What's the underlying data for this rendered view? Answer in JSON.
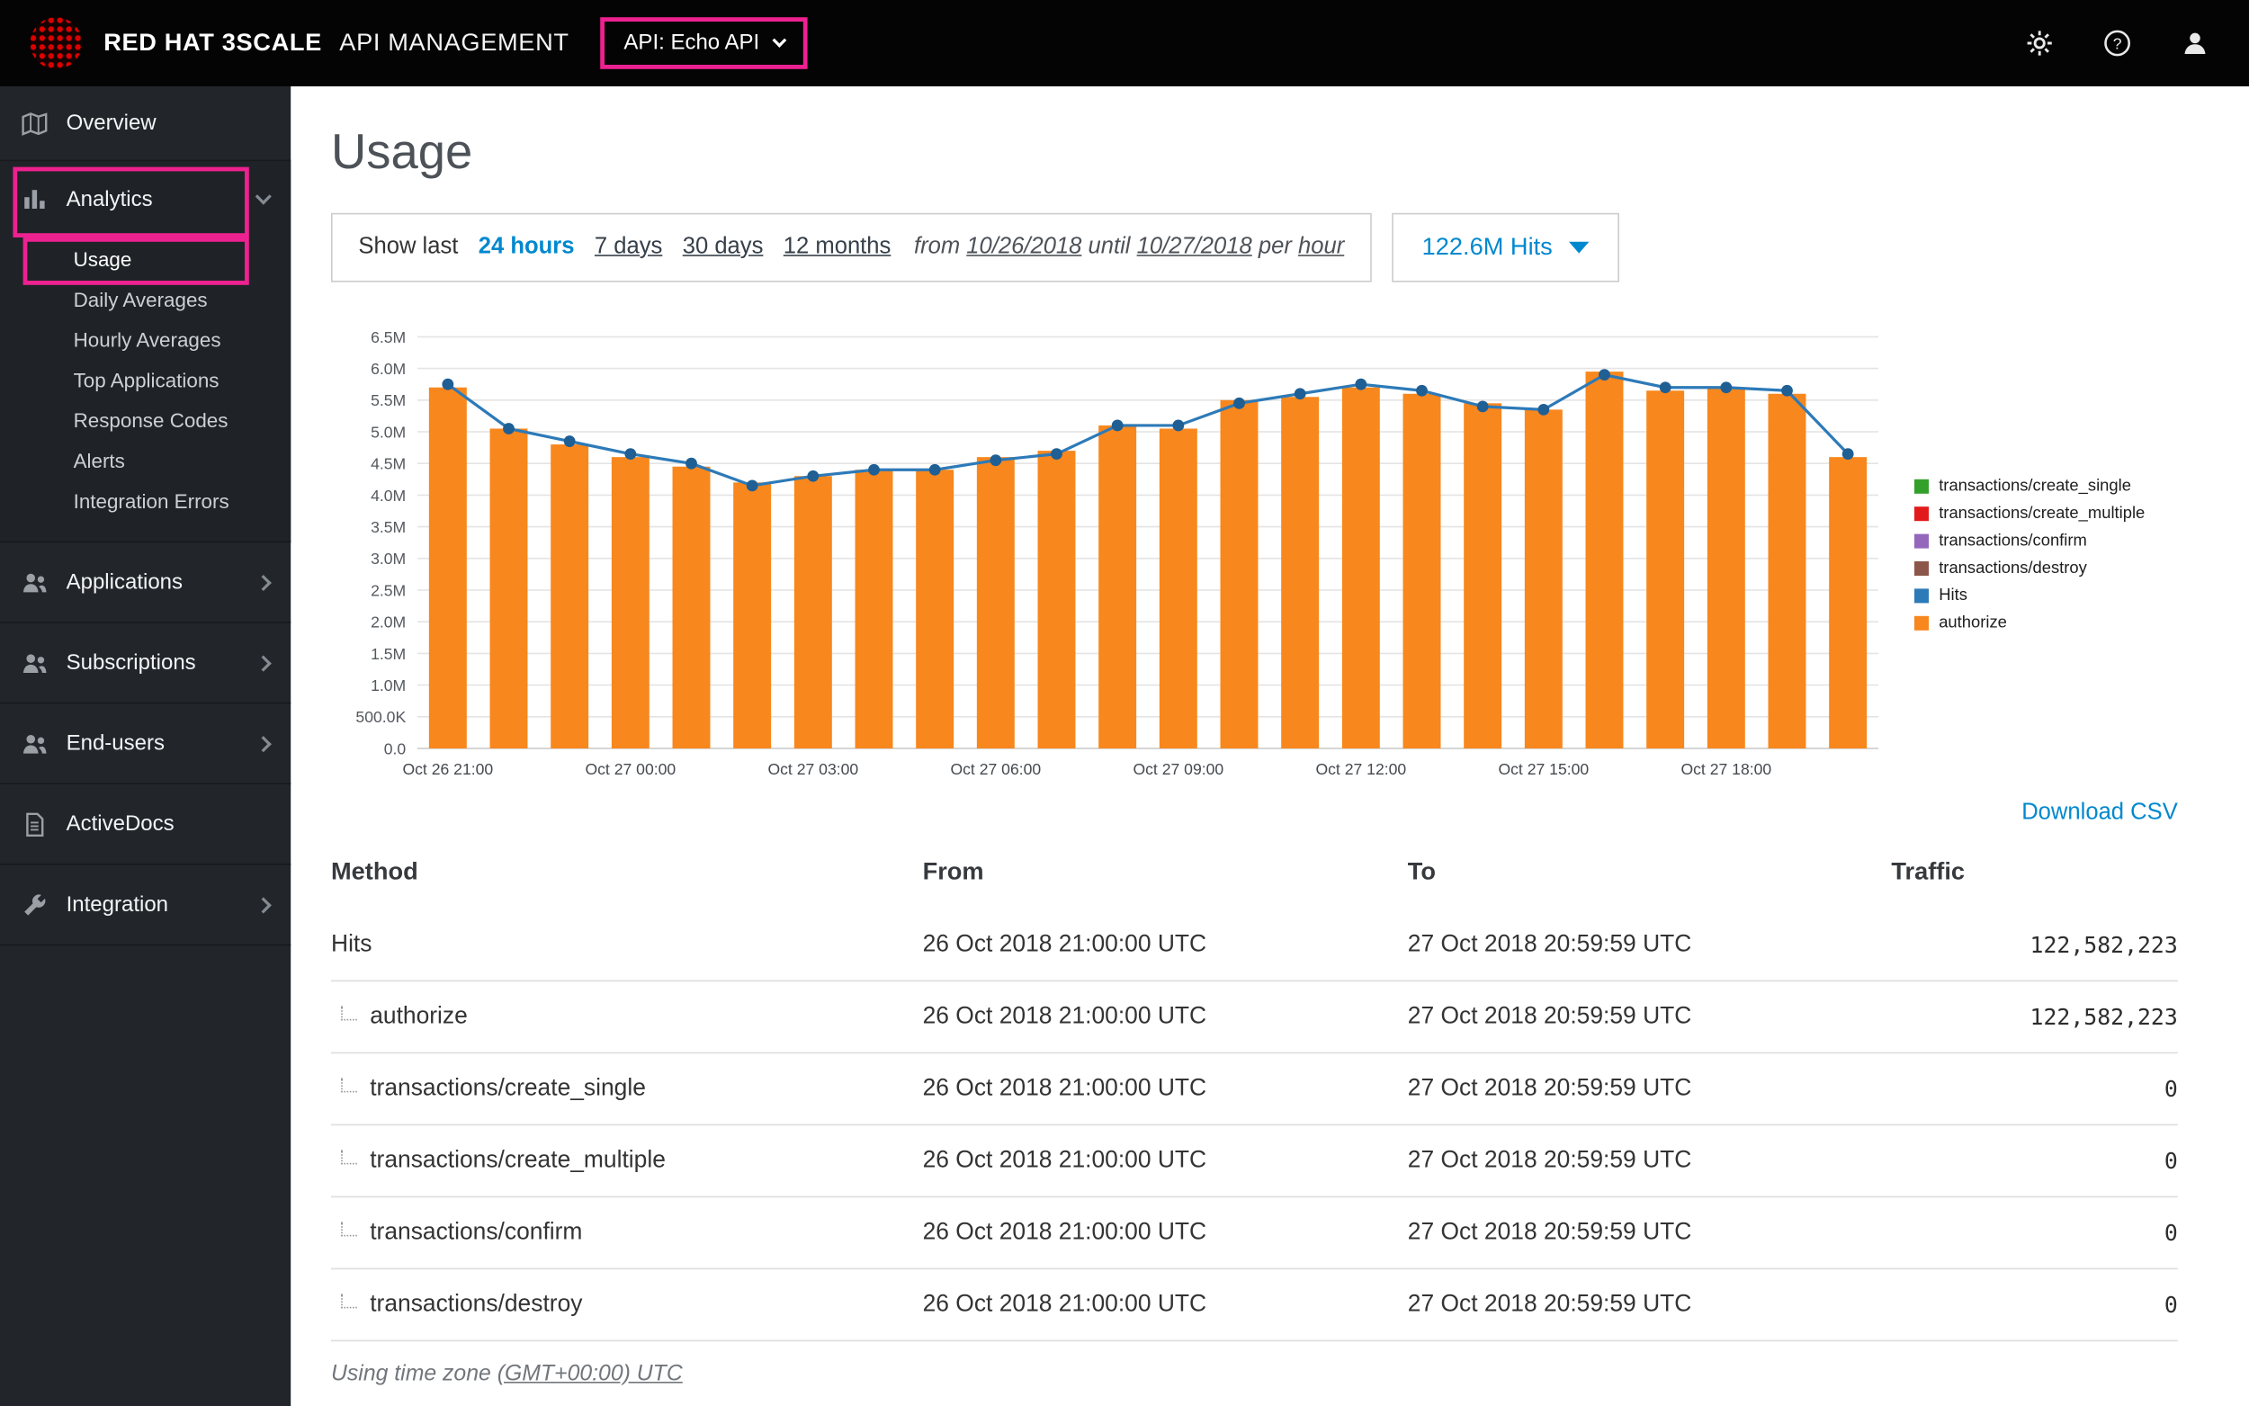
{
  "topbar": {
    "brand_bold": "RED HAT 3SCALE",
    "brand_light": "API MANAGEMENT",
    "api_selector": "API: Echo API",
    "icons": [
      "gear-icon",
      "help-icon",
      "user-icon"
    ],
    "annotation_color": "#ed2190"
  },
  "sidebar": {
    "overview": "Overview",
    "analytics": "Analytics",
    "analytics_items": [
      "Usage",
      "Daily Averages",
      "Hourly Averages",
      "Top Applications",
      "Response Codes",
      "Alerts",
      "Integration Errors"
    ],
    "active_item": "Usage",
    "sections": [
      {
        "label": "Applications",
        "icon": "users-icon",
        "chevron": true
      },
      {
        "label": "Subscriptions",
        "icon": "users-icon",
        "chevron": true
      },
      {
        "label": "End-users",
        "icon": "users-icon",
        "chevron": true
      },
      {
        "label": "ActiveDocs",
        "icon": "document-icon",
        "chevron": false
      },
      {
        "label": "Integration",
        "icon": "wrench-icon",
        "chevron": true
      }
    ]
  },
  "main": {
    "title": "Usage",
    "filter": {
      "show_last": "Show last",
      "ranges": [
        "24 hours",
        "7 days",
        "30 days",
        "12 months"
      ],
      "active_range": "24 hours",
      "from_label": "from",
      "from_date": "10/26/2018",
      "until_label": "until",
      "until_date": "10/27/2018",
      "per_label": "per",
      "granularity": "hour"
    },
    "metric_dropdown": "122.6M Hits",
    "download_csv": "Download CSV",
    "timezone_prefix": "Using time zone",
    "timezone_link": "(GMT+00:00) UTC"
  },
  "chart_data": {
    "type": "bar",
    "title": "",
    "xlabel": "",
    "ylabel": "",
    "ylim": [
      0,
      6500000
    ],
    "y_tick_step": 500000,
    "y_ticks": [
      "6.5M",
      "6.0M",
      "5.5M",
      "5.0M",
      "4.5M",
      "4.0M",
      "3.5M",
      "3.0M",
      "2.5M",
      "2.0M",
      "1.5M",
      "1.0M",
      "500.0K",
      "0.0"
    ],
    "x_tick_every": 3,
    "x_tick_labels": [
      "Oct 26 21:00",
      "Oct 27 00:00",
      "Oct 27 03:00",
      "Oct 27 06:00",
      "Oct 27 09:00",
      "Oct 27 12:00",
      "Oct 27 15:00",
      "Oct 27 18:00"
    ],
    "categories": [
      "Oct 26 21:00",
      "Oct 26 22:00",
      "Oct 26 23:00",
      "Oct 27 00:00",
      "Oct 27 01:00",
      "Oct 27 02:00",
      "Oct 27 03:00",
      "Oct 27 04:00",
      "Oct 27 05:00",
      "Oct 27 06:00",
      "Oct 27 07:00",
      "Oct 27 08:00",
      "Oct 27 09:00",
      "Oct 27 10:00",
      "Oct 27 11:00",
      "Oct 27 12:00",
      "Oct 27 13:00",
      "Oct 27 14:00",
      "Oct 27 15:00",
      "Oct 27 16:00",
      "Oct 27 17:00",
      "Oct 27 18:00",
      "Oct 27 19:00",
      "Oct 27 20:00"
    ],
    "series": [
      {
        "name": "authorize",
        "type": "bar",
        "color": "#f8871d",
        "values": [
          5700000,
          5050000,
          4800000,
          4600000,
          4450000,
          4200000,
          4300000,
          4400000,
          4400000,
          4600000,
          4700000,
          5100000,
          5050000,
          5500000,
          5550000,
          5700000,
          5600000,
          5450000,
          5350000,
          5950000,
          5650000,
          5700000,
          5600000,
          4600000
        ]
      },
      {
        "name": "Hits",
        "type": "line",
        "color": "#2d7ab8",
        "dot_color": "#1f5f94",
        "values": [
          5750000,
          5050000,
          4850000,
          4650000,
          4500000,
          4150000,
          4300000,
          4400000,
          4400000,
          4550000,
          4650000,
          5100000,
          5100000,
          5450000,
          5600000,
          5750000,
          5650000,
          5400000,
          5350000,
          5900000,
          5700000,
          5700000,
          5650000,
          4650000
        ]
      }
    ],
    "legend": [
      {
        "label": "transactions/create_single",
        "color": "#33a02c"
      },
      {
        "label": "transactions/create_multiple",
        "color": "#e31a1c"
      },
      {
        "label": "transactions/confirm",
        "color": "#9467bd"
      },
      {
        "label": "transactions/destroy",
        "color": "#8c564b"
      },
      {
        "label": "Hits",
        "color": "#2d7ab8"
      },
      {
        "label": "authorize",
        "color": "#f8871d"
      }
    ],
    "legend_position": "right",
    "grid": true
  },
  "table": {
    "headers": [
      "Method",
      "From",
      "To",
      "Traffic"
    ],
    "rows": [
      {
        "method": "Hits",
        "indent": false,
        "from": "26 Oct 2018 21:00:00 UTC",
        "to": "27 Oct 2018 20:59:59 UTC",
        "traffic": "122,582,223"
      },
      {
        "method": "authorize",
        "indent": true,
        "from": "26 Oct 2018 21:00:00 UTC",
        "to": "27 Oct 2018 20:59:59 UTC",
        "traffic": "122,582,223"
      },
      {
        "method": "transactions/create_single",
        "indent": true,
        "from": "26 Oct 2018 21:00:00 UTC",
        "to": "27 Oct 2018 20:59:59 UTC",
        "traffic": "0"
      },
      {
        "method": "transactions/create_multiple",
        "indent": true,
        "from": "26 Oct 2018 21:00:00 UTC",
        "to": "27 Oct 2018 20:59:59 UTC",
        "traffic": "0"
      },
      {
        "method": "transactions/confirm",
        "indent": true,
        "from": "26 Oct 2018 21:00:00 UTC",
        "to": "27 Oct 2018 20:59:59 UTC",
        "traffic": "0"
      },
      {
        "method": "transactions/destroy",
        "indent": true,
        "from": "26 Oct 2018 21:00:00 UTC",
        "to": "27 Oct 2018 20:59:59 UTC",
        "traffic": "0"
      }
    ]
  }
}
